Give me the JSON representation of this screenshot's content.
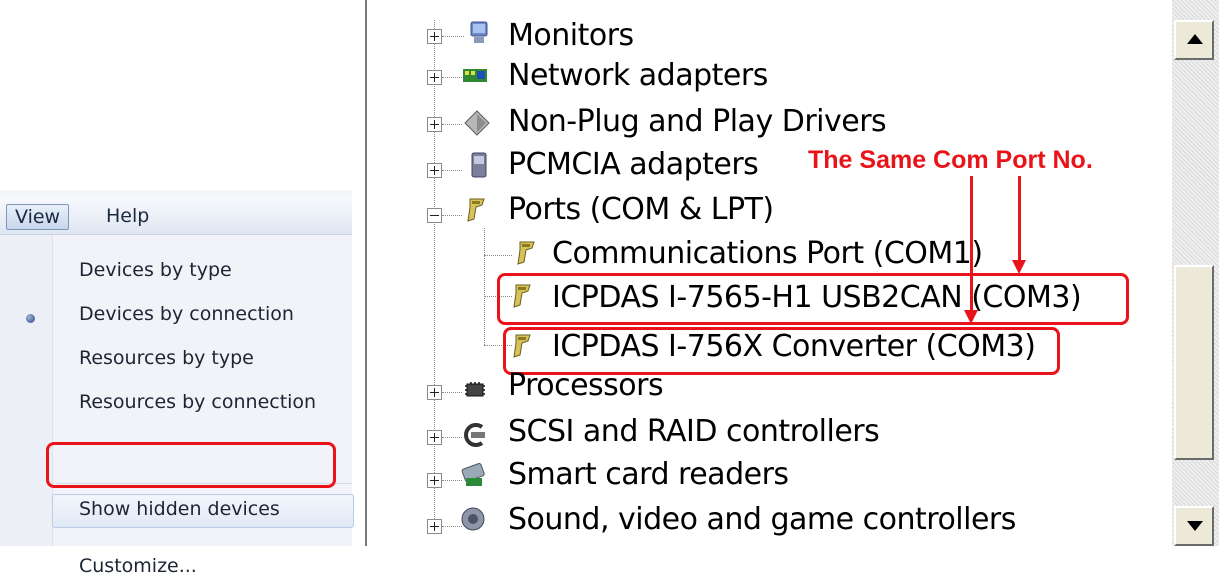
{
  "menubar": {
    "view_label": "View",
    "help_label": "Help"
  },
  "view_menu": {
    "items": [
      {
        "label": "Devices by type",
        "checked": true
      },
      {
        "label": "Devices by connection"
      },
      {
        "label": "Resources by type"
      },
      {
        "label": "Resources by connection"
      },
      {
        "label": "Show hidden devices"
      },
      {
        "label": "Customize..."
      }
    ]
  },
  "device_tree": {
    "categories": [
      {
        "label": "Monitors",
        "icon": "monitor-icon"
      },
      {
        "label": "Network adapters",
        "icon": "network-adapter-icon"
      },
      {
        "label": "Non-Plug and Play Drivers",
        "icon": "driver-diamond-icon"
      },
      {
        "label": "PCMCIA adapters",
        "icon": "pcmcia-icon"
      },
      {
        "label": "Ports (COM & LPT)",
        "icon": "port-plug-icon",
        "expanded": true
      },
      {
        "label": "Processors",
        "icon": "processor-icon"
      },
      {
        "label": "SCSI and RAID controllers",
        "icon": "scsi-icon"
      },
      {
        "label": "Smart card readers",
        "icon": "smart-card-icon"
      },
      {
        "label": "Sound, video and game controllers",
        "icon": "sound-icon"
      }
    ],
    "ports": [
      {
        "label": "Communications Port (COM1)"
      },
      {
        "label": "ICPDAS I-7565-H1 USB2CAN (COM3)"
      },
      {
        "label": "ICPDAS I-756X Converter (COM3)"
      }
    ]
  },
  "annotation": {
    "text": "The Same Com Port No.",
    "color": "#e8141a"
  },
  "colors": {
    "highlight_red": "#e8141a"
  }
}
